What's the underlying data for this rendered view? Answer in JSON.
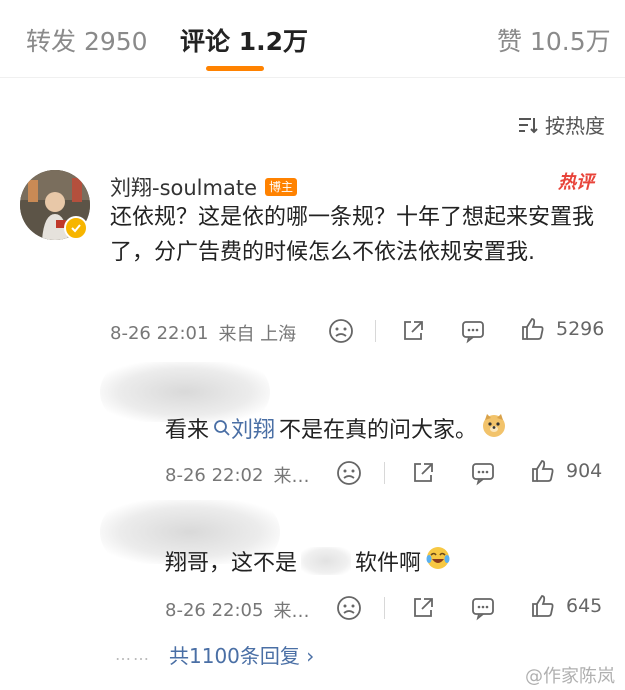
{
  "tabs": {
    "repost": "转发 2950",
    "comments": "评论 1.2万",
    "likes": "赞 10.5万"
  },
  "sort": {
    "label": "按热度",
    "icon": "sort-icon"
  },
  "main_comment": {
    "username": "刘翔-soulmate",
    "role_badge": "博主",
    "hot_tag": "热评",
    "text": "还依规？这是依的哪一条规？十年了想起来安置我了，分广告费的时候怎么不依法依规安置我.",
    "time": "8-26 22:01",
    "location": "来自 上海",
    "like_count": "5296"
  },
  "replies": [
    {
      "text_before": "看来",
      "mention": "刘翔",
      "text_after": "不是在真的问大家。",
      "emoji": "doge-emoji",
      "time": "8-26 22:02",
      "location": "来…",
      "like_count": "904"
    },
    {
      "text_before": "翔哥，这不是",
      "text_after": "软件啊",
      "emoji": "laugh-cry-emoji",
      "time": "8-26 22:05",
      "location": "来…",
      "like_count": "645"
    }
  ],
  "more_replies": {
    "dots": "……",
    "label": "共1100条回复 ›"
  },
  "watermark": "@作家陈岚",
  "colors": {
    "accent": "#ff8200",
    "link": "#4a6fa5",
    "hot": "#e8443a",
    "muted": "#8a8a8a"
  }
}
